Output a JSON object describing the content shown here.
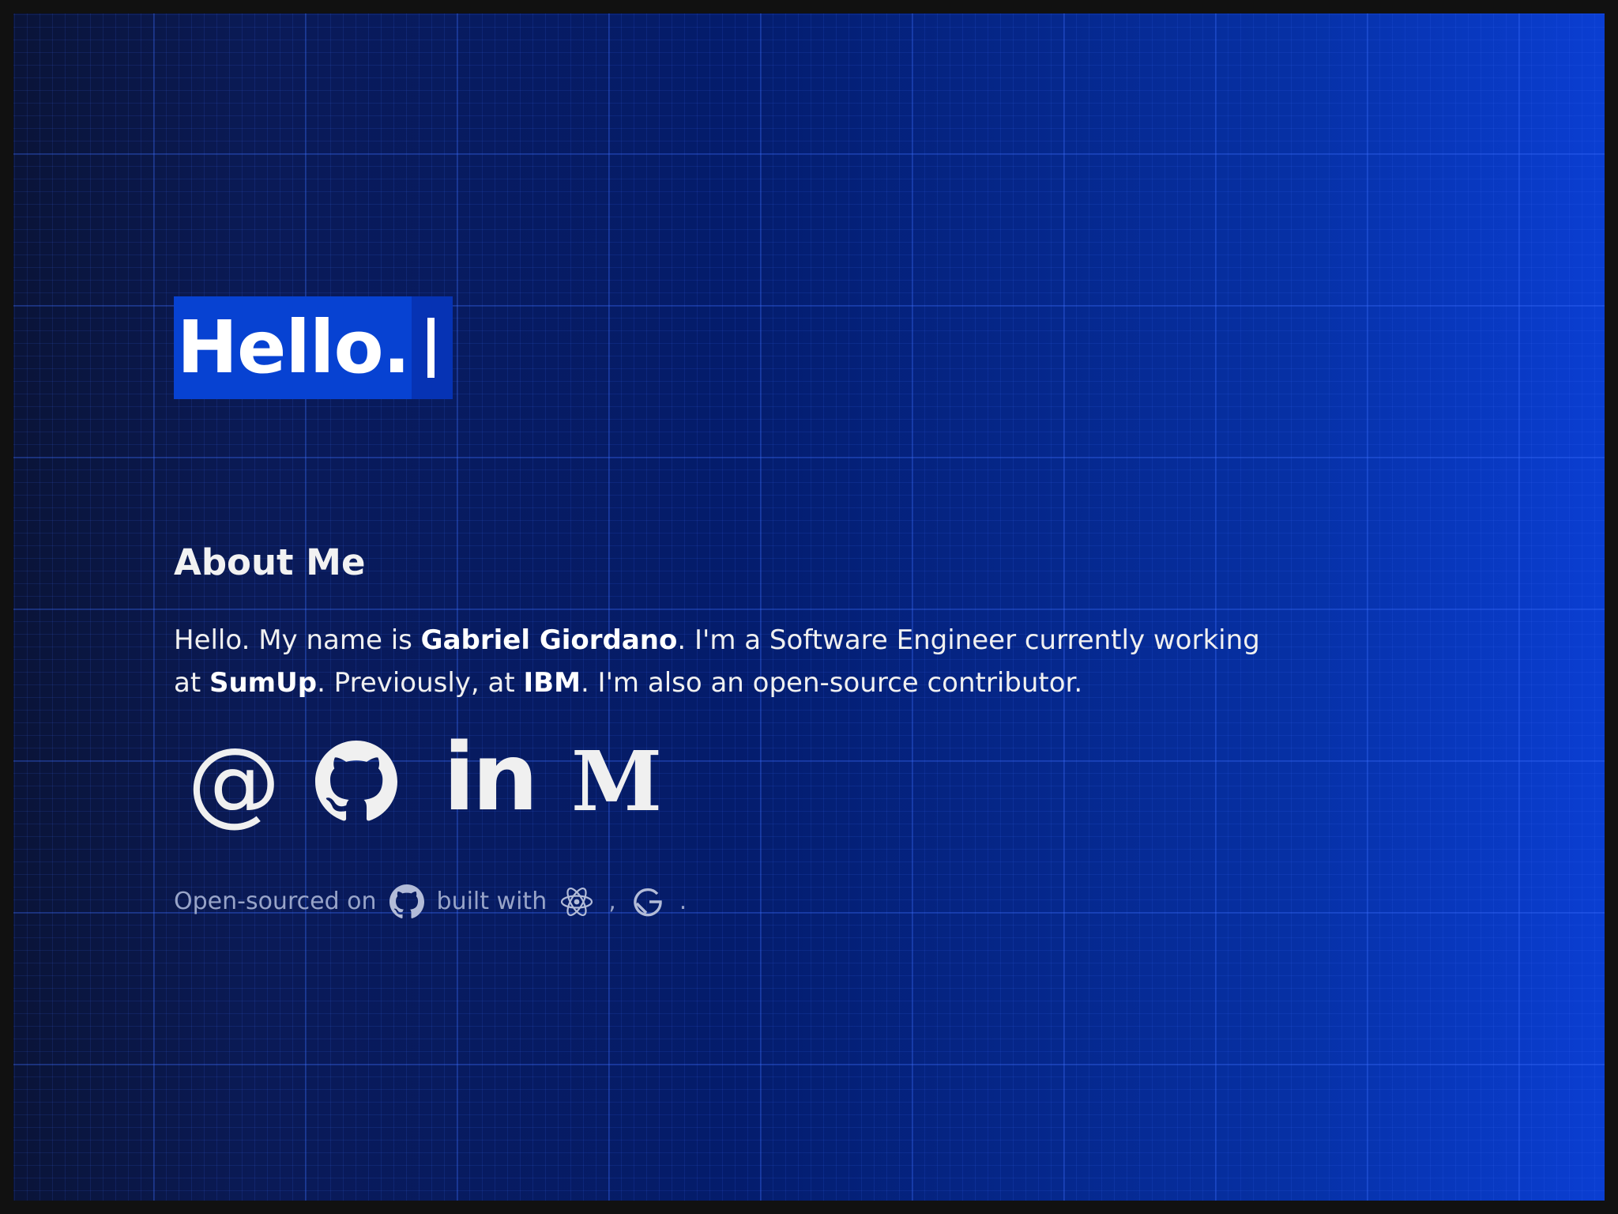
{
  "hero": {
    "greeting": "Hello."
  },
  "about": {
    "heading": "About Me",
    "intro": "Hello. My name is ",
    "name": "Gabriel Giordano",
    "role_text": ". I'm a Software Engineer currently working at ",
    "current_company": "SumUp",
    "previous_text": ". Previously, at ",
    "previous_company": "IBM",
    "closing_text": ". I'm also an open-source contributor."
  },
  "social": {
    "links": [
      {
        "name": "email",
        "icon": "at-icon",
        "glyph": "@"
      },
      {
        "name": "github",
        "icon": "github-icon"
      },
      {
        "name": "linkedin",
        "icon": "linkedin-icon",
        "glyph": "in"
      },
      {
        "name": "medium",
        "icon": "medium-icon",
        "glyph": "M"
      }
    ]
  },
  "footer": {
    "open_sourced_text": "Open-sourced on",
    "built_with_text": "built with",
    "comma": ",",
    "period": ".",
    "icons": [
      "github-icon",
      "react-icon",
      "gatsby-icon"
    ]
  },
  "colors": {
    "background": "#031a5e",
    "hero_highlight": "#0742d2",
    "text": "#ffffff",
    "muted_text": "#98a4c8"
  }
}
